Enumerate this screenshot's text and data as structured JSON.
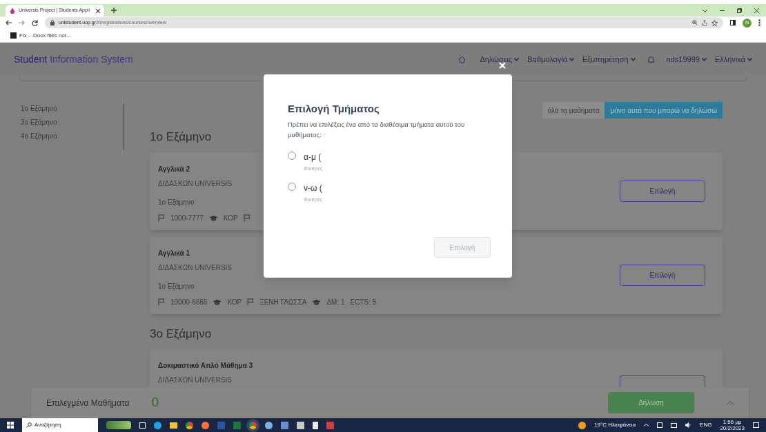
{
  "browser": {
    "tab_title": "Universis Project | Students Appli",
    "url_host": "unistudent.uop.gr",
    "url_path": "/#/registrations/courses/overview",
    "bookmark": "Fix - .Docx files not...",
    "avatar": "N"
  },
  "app": {
    "title_strong": "Student",
    "title_rest": "Information System",
    "nav": [
      {
        "kind": "home"
      },
      {
        "kind": "menu",
        "label": "Δηλώσεις"
      },
      {
        "kind": "menu",
        "label": "Βαθμολογία"
      },
      {
        "kind": "menu",
        "label": "Εξυπηρέτηση"
      },
      {
        "kind": "bell"
      },
      {
        "kind": "menu",
        "label": "nds19999"
      },
      {
        "kind": "menu",
        "label": "Ελληνικά"
      }
    ]
  },
  "sidebar": [
    "1ο Εξάμηνο",
    "3ο Εξάμηνο",
    "4ο Εξάμηνο"
  ],
  "filters": [
    {
      "label": "όλα τα μαθήματα",
      "selected": false
    },
    {
      "label": "μόνο αυτά που μπορώ να δηλώσω",
      "selected": true
    }
  ],
  "sections": [
    {
      "heading": "1ο Εξάμηνο",
      "courses": [
        {
          "name": "Αγγλικά 2",
          "instructor": "ΔΙΔΑΣΚΩΝ UNIVERSIS",
          "semester": "1ο Εξάμηνο",
          "meta": [
            {
              "kind": "flag",
              "text": "1000-7777"
            },
            {
              "kind": "cap",
              "text": "ΚΟΡ"
            },
            {
              "kind": "flag"
            }
          ],
          "button": "Επιλογή"
        },
        {
          "name": "Αγγλικά 1",
          "instructor": "ΔΙΔΑΣΚΩΝ UNIVERSIS",
          "semester": "1ο Εξάμηνο",
          "meta": [
            {
              "kind": "flag",
              "text": "10000-6666"
            },
            {
              "kind": "cap",
              "text": "ΚΟΡ"
            },
            {
              "kind": "flag",
              "text": "ΞΕΝΗ ΓΛΩΣΣΑ"
            },
            {
              "kind": "cap",
              "text": "ΔΜ: 1"
            },
            {
              "kind": "plain",
              "text": "ECTS: 5"
            }
          ],
          "button": "Επιλογή"
        }
      ]
    },
    {
      "heading": "3ο Εξάμηνο",
      "courses": [
        {
          "name": "Δοκιμαστικό Απλό Μάθημα 3",
          "instructor": "ΔΙΔΑΣΚΩΝ UNIVERSIS"
        }
      ]
    }
  ],
  "bottom_bar": {
    "label": "Επιλεγμένα Μαθήματα",
    "count": "0",
    "button": "Δήλωση"
  },
  "modal": {
    "title": "Επιλογή Τμήματος",
    "description": "Πρέπει να επιλέξεις ένα από τα διαθέσιμα τμήματα αυτού του μαθήματος:",
    "options": [
      {
        "label": "α-μ (",
        "sublabel": "Φοιτητές",
        "selected": false
      },
      {
        "label": "ν-ω (",
        "sublabel": "Φοιτητές",
        "selected": false
      }
    ],
    "button": {
      "label": "Επιλογή",
      "disabled": true
    }
  },
  "taskbar": {
    "search": "Αναζήτηση",
    "weather": "19°C Ηλιοφάνεια",
    "language": "ENG",
    "time": "1:56 μμ",
    "date": "20/2/2023"
  }
}
